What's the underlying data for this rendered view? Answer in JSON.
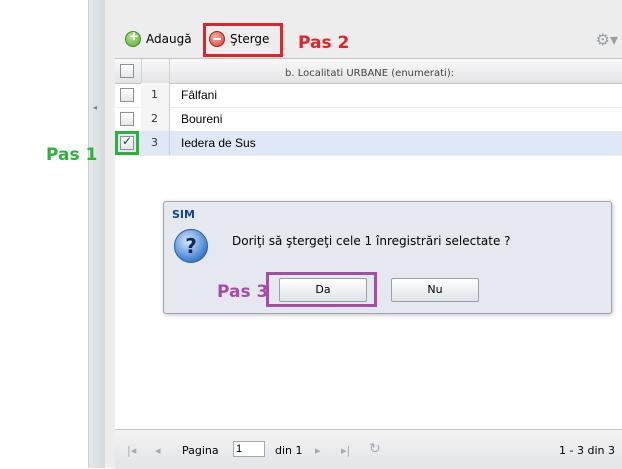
{
  "annotations": {
    "pas1": "Pas 1",
    "pas2": "Pas 2",
    "pas3": "Pas 3"
  },
  "toolbar": {
    "add_label": "Adaugă",
    "delete_label": "Şterge"
  },
  "grid": {
    "column_header": "b. Localitati URBANE (enumerati):",
    "rows": [
      {
        "num": "1",
        "name": "Fâlfani",
        "checked": false
      },
      {
        "num": "2",
        "name": "Boureni",
        "checked": false
      },
      {
        "num": "3",
        "name": "Iedera de Sus",
        "checked": true
      }
    ]
  },
  "dialog": {
    "title": "SIM",
    "message": "Doriţi să ştergeţi cele 1 înregistrări selectate ?",
    "yes_label": "Da",
    "no_label": "Nu"
  },
  "pager": {
    "page_label": "Pagina",
    "page_value": "1",
    "of_label": "din 1",
    "range": "1 - 3 din 3"
  },
  "colors": {
    "annotation_red": "#e0242a",
    "annotation_green": "#2cb23b",
    "annotation_purple": "#a64ca6",
    "selected_row": "#dfe8f6"
  }
}
